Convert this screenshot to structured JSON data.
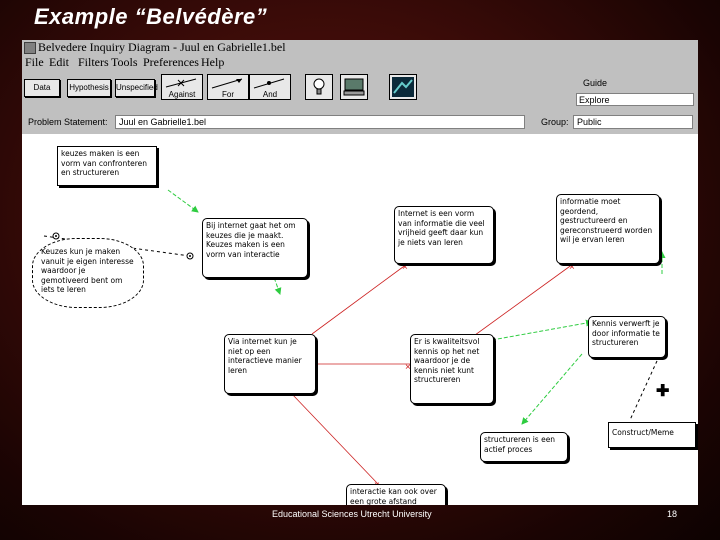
{
  "slide": {
    "title": "Example “Belvédère”",
    "footer": "Educational Sciences Utrecht University",
    "page_number": "18"
  },
  "window": {
    "title": "Belvedere Inquiry Diagram - Juul en Gabrielle1.bel",
    "menu": [
      "File",
      "Edit",
      "Filters",
      "Tools",
      "Preferences",
      "Help"
    ]
  },
  "toolbar": {
    "buttons": [
      "Data",
      "Hypothesis",
      "Unspecified"
    ],
    "link_buttons": [
      "Against",
      "For",
      "And"
    ],
    "icon_buttons": [
      "lightbulb-icon",
      "computer-icon",
      "browser-icon"
    ]
  },
  "guide": {
    "label": "Guide",
    "value": "Explore"
  },
  "problem": {
    "label": "Problem Statement:",
    "value": "Juul en Gabrielle1.bel"
  },
  "group": {
    "label": "Group:",
    "value": "Public"
  },
  "nodes": [
    "keuzes maken is een vorm van confronteren en structureren",
    "Keuzes kun je maken vanuit je eigen interesse waardoor je gemotiveerd bent om iets te leren",
    "Bij internet gaat het om keuzes die je maakt. Keuzes maken is een vorm van interactie",
    "Internet is een vorm van informatie die veel vrijheid geeft daar kun je niets van leren",
    "informatie moet geordend, gestructureerd en gereconstrueerd worden wil je ervan leren",
    "Via internet kun je niet op een interactieve manier leren",
    "Er is kwaliteitsvol kennis op het net waardoor je de kennis niet kunt structureren",
    "Kennis verwerft je door informatie te structureren",
    "structureren is een actief proces",
    "Construct/Meme",
    "interactie kan ook over een grote afstand plaats vinden"
  ]
}
